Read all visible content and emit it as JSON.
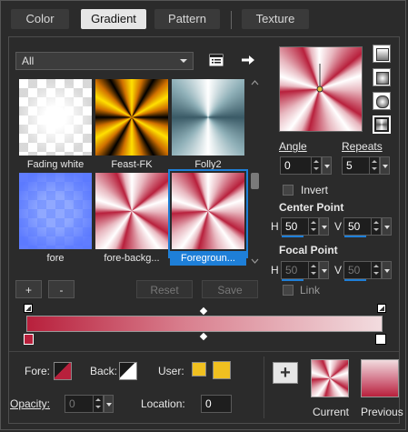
{
  "tabs": [
    {
      "label": "Color",
      "active": false
    },
    {
      "label": "Gradient",
      "active": true
    },
    {
      "label": "Pattern",
      "active": false
    },
    {
      "label": "Texture",
      "active": false
    }
  ],
  "category_dropdown": {
    "value": "All"
  },
  "gradients": [
    {
      "label": "Fading white"
    },
    {
      "label": "Feast-FK"
    },
    {
      "label": "Folly2"
    },
    {
      "label": "fore"
    },
    {
      "label": "fore-backg..."
    },
    {
      "label": "Foregroun...",
      "selected": true
    }
  ],
  "buttons": {
    "add": "+",
    "remove": "-",
    "reset": "Reset",
    "save": "Save",
    "new": "+"
  },
  "angle": {
    "label": "Angle",
    "value": "0"
  },
  "repeats": {
    "label": "Repeats",
    "value": "5"
  },
  "invert": {
    "label": "Invert"
  },
  "center_point": {
    "title": "Center Point",
    "h_label": "H",
    "h_value": "50",
    "v_label": "V",
    "v_value": "50"
  },
  "focal_point": {
    "title": "Focal Point",
    "h_label": "H",
    "h_value": "50",
    "v_label": "V",
    "v_value": "50"
  },
  "link": {
    "label": "Link"
  },
  "bottom": {
    "fore_label": "Fore:",
    "back_label": "Back:",
    "user_label": "User:",
    "opacity_label": "Opacity:",
    "opacity_value": "0",
    "location_label": "Location:",
    "location_value": "0",
    "current_label": "Current",
    "previous_label": "Previous"
  },
  "colors": {
    "accent": "#1e7fd8",
    "rose": "#b8203c",
    "rose_light": "#e8b8c0",
    "user_yellow": "#f0c020"
  }
}
